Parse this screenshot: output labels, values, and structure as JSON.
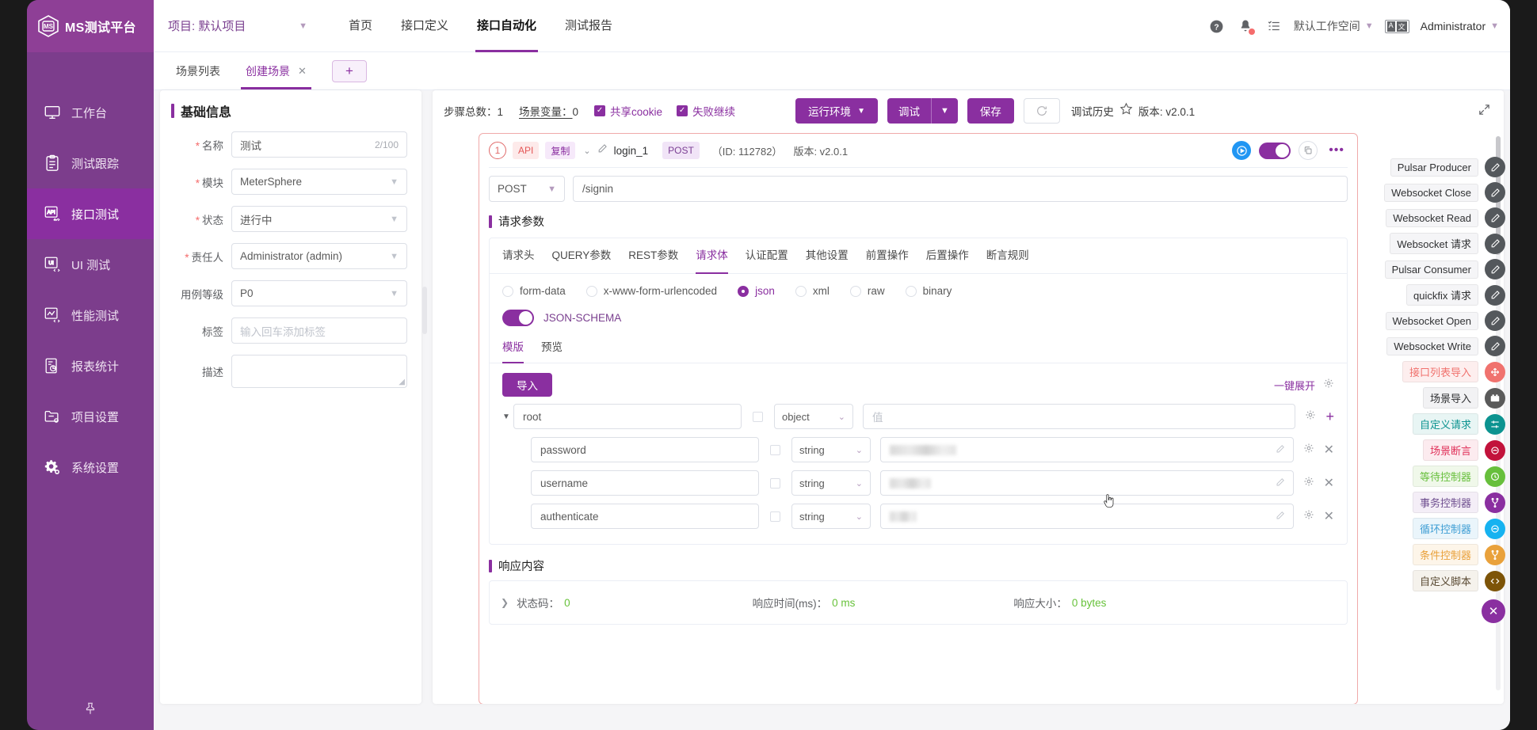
{
  "brand": {
    "name": "MS测试平台",
    "accent": "#8a2fa0"
  },
  "topbar": {
    "project_label": "项目: 默认项目",
    "nav": [
      {
        "label": "首页",
        "active": false
      },
      {
        "label": "接口定义",
        "active": false
      },
      {
        "label": "接口自动化",
        "active": true
      },
      {
        "label": "测试报告",
        "active": false
      }
    ],
    "help_icon": "help-circle-icon",
    "bell_icon": "bell-icon",
    "tasks_icon": "task-list-icon",
    "workspace": "默认工作空间",
    "lang_a": "A",
    "lang_z": "文",
    "user": "Administrator"
  },
  "tabstrip": {
    "tabs": [
      {
        "label": "场景列表",
        "active": false,
        "closable": false
      },
      {
        "label": "创建场景",
        "active": true,
        "closable": true
      }
    ],
    "add_label": "+"
  },
  "basic": {
    "title": "基础信息",
    "fields": [
      {
        "label": "名称",
        "required": true,
        "value": "测试",
        "count": "2/100",
        "type": "text"
      },
      {
        "label": "模块",
        "required": true,
        "value": "MeterSphere",
        "type": "select"
      },
      {
        "label": "状态",
        "required": true,
        "value": "进行中",
        "type": "select"
      },
      {
        "label": "责任人",
        "required": true,
        "value": "Administrator (admin)",
        "type": "select"
      },
      {
        "label": "用例等级",
        "required": false,
        "value": "P0",
        "type": "select"
      },
      {
        "label": "标签",
        "required": false,
        "value": "",
        "placeholder": "输入回车添加标签",
        "type": "text"
      },
      {
        "label": "描述",
        "required": false,
        "value": "",
        "type": "textarea"
      }
    ]
  },
  "toolbar": {
    "step_total_label": "步骤总数：",
    "step_total_value": "1",
    "scene_var_label": "场景变量：",
    "scene_var_value": "0",
    "share_cookie": "共享cookie",
    "fail_continue": "失败继续",
    "run_env": "运行环境",
    "debug": "调试",
    "save": "保存",
    "refresh_icon": "refresh-icon",
    "debug_history": "调试历史",
    "star_icon": "star-icon",
    "version": "版本: v2.0.1",
    "expand_icon": "expand-icon"
  },
  "api_card": {
    "step_number": "1",
    "type_badge": "API",
    "copy_badge": "复制",
    "name": "login_1",
    "method_badge": "POST",
    "id_text": "（ID: 112782）",
    "version": "版本: v2.0.1",
    "play_icon": "play-circle-icon",
    "enabled": true,
    "copy_icon": "copy-icon",
    "more_icon": "more-dots-icon",
    "method": "POST",
    "path": "/signin",
    "params_title": "请求参数",
    "tabs": [
      {
        "label": "请求头",
        "active": false
      },
      {
        "label": "QUERY参数",
        "active": false
      },
      {
        "label": "REST参数",
        "active": false
      },
      {
        "label": "请求体",
        "active": true
      },
      {
        "label": "认证配置",
        "active": false
      },
      {
        "label": "其他设置",
        "active": false
      },
      {
        "label": "前置操作",
        "active": false
      },
      {
        "label": "后置操作",
        "active": false
      },
      {
        "label": "断言规则",
        "active": false
      }
    ],
    "body_types": [
      {
        "label": "form-data",
        "selected": false
      },
      {
        "label": "x-www-form-urlencoded",
        "selected": false
      },
      {
        "label": "json",
        "selected": true
      },
      {
        "label": "xml",
        "selected": false
      },
      {
        "label": "raw",
        "selected": false
      },
      {
        "label": "binary",
        "selected": false
      }
    ],
    "json_schema_label": "JSON-SCHEMA",
    "json_schema_on": true,
    "sub_tabs": [
      {
        "label": "模版",
        "active": true
      },
      {
        "label": "预览",
        "active": false
      }
    ],
    "import_label": "导入",
    "expand_all_label": "一键展开",
    "settings_icon": "gear-icon",
    "schema_rows": [
      {
        "key": "root",
        "type": "object",
        "value": "",
        "value_placeholder": "值",
        "masked": false,
        "is_root": true,
        "checked": false
      },
      {
        "key": "password",
        "type": "string",
        "value": "",
        "value_placeholder": "",
        "masked": true,
        "is_root": false,
        "checked": false
      },
      {
        "key": "username",
        "type": "string",
        "value": "",
        "value_placeholder": "",
        "masked": true,
        "is_root": false,
        "checked": false
      },
      {
        "key": "authenticate",
        "type": "string",
        "value": "",
        "value_placeholder": "",
        "masked": true,
        "is_root": false,
        "checked": false
      }
    ],
    "response_title": "响应内容",
    "response": {
      "status_label": "状态码：",
      "status_value": "0",
      "time_label": "响应时间(ms)：",
      "time_value": "0 ms",
      "size_label": "响应大小：",
      "size_value": "0 bytes"
    }
  },
  "sidebar_rail": {
    "items": [
      {
        "label": "工作台",
        "icon": "monitor-icon",
        "active": false
      },
      {
        "label": "测试跟踪",
        "icon": "clipboard-icon",
        "active": false
      },
      {
        "label": "接口测试",
        "icon": "api-icon",
        "active": true
      },
      {
        "label": "UI 测试",
        "icon": "ui-icon",
        "active": false
      },
      {
        "label": "性能测试",
        "icon": "performance-icon",
        "active": false
      },
      {
        "label": "报表统计",
        "icon": "report-icon",
        "active": false
      },
      {
        "label": "项目设置",
        "icon": "folder-settings-icon",
        "active": false
      },
      {
        "label": "系统设置",
        "icon": "gears-icon",
        "active": false
      }
    ],
    "pin_icon": "pin-icon"
  },
  "fab_actions": [
    {
      "label": "Pulsar Producer",
      "icon": "pencil-icon",
      "color": "#54585c",
      "text_color": "#303133",
      "bg": "#f5f5f7"
    },
    {
      "label": "Websocket Close",
      "icon": "pencil-icon",
      "color": "#54585c",
      "text_color": "#303133",
      "bg": "#f5f5f7"
    },
    {
      "label": "Websocket Read",
      "icon": "pencil-icon",
      "color": "#54585c",
      "text_color": "#303133",
      "bg": "#f5f5f7"
    },
    {
      "label": "Websocket 请求",
      "icon": "pencil-icon",
      "color": "#54585c",
      "text_color": "#303133",
      "bg": "#f5f5f7"
    },
    {
      "label": "Pulsar Consumer",
      "icon": "pencil-icon",
      "color": "#54585c",
      "text_color": "#303133",
      "bg": "#f5f5f7"
    },
    {
      "label": "quickfix 请求",
      "icon": "pencil-icon",
      "color": "#54585c",
      "text_color": "#303133",
      "bg": "#f5f5f7"
    },
    {
      "label": "Websocket Open",
      "icon": "pencil-icon",
      "color": "#54585c",
      "text_color": "#303133",
      "bg": "#f5f5f7"
    },
    {
      "label": "Websocket Write",
      "icon": "pencil-icon",
      "color": "#54585c",
      "text_color": "#303133",
      "bg": "#f5f5f7"
    },
    {
      "label": "接口列表导入",
      "icon": "import-icon",
      "color": "#f0726e",
      "text_color": "#f0726e",
      "bg": "#fdeeee"
    },
    {
      "label": "场景导入",
      "icon": "scene-icon",
      "color": "#5a5a5a",
      "text_color": "#303133",
      "bg": "#f2f2f4"
    },
    {
      "label": "自定义请求",
      "icon": "custom-request-icon",
      "color": "#0c9390",
      "text_color": "#0c9390",
      "bg": "#e8f5f4"
    },
    {
      "label": "场景断言",
      "icon": "assert-icon",
      "color": "#c2123b",
      "text_color": "#e0315a",
      "bg": "#fcebef"
    },
    {
      "label": "等待控制器",
      "icon": "clock-icon",
      "color": "#67bf3c",
      "text_color": "#67bf3c",
      "bg": "#f0f8ea"
    },
    {
      "label": "事务控制器",
      "icon": "branch-icon",
      "color": "#8a2fa0",
      "text_color": "#6e4e8f",
      "bg": "#f4eef7"
    },
    {
      "label": "循环控制器",
      "icon": "loop-icon",
      "color": "#16b2f0",
      "text_color": "#3f9ed4",
      "bg": "#eaf5fb"
    },
    {
      "label": "条件控制器",
      "icon": "condition-icon",
      "color": "#e9a13b",
      "text_color": "#e9a13b",
      "bg": "#fdf5e9"
    },
    {
      "label": "自定义脚本",
      "icon": "code-icon",
      "color": "#7d5408",
      "text_color": "#5a4a33",
      "bg": "#f5f2ec"
    }
  ],
  "fab_close_icon": "close-icon"
}
